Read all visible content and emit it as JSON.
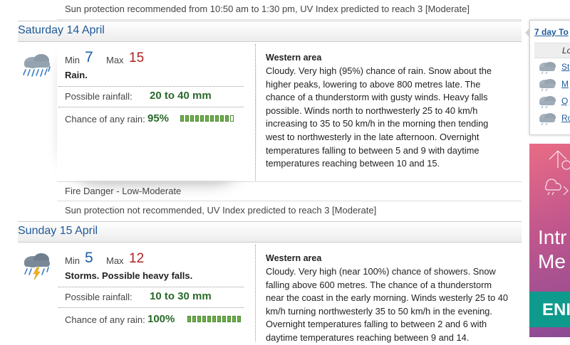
{
  "top_note": "Sun protection recommended from 10:50 am to 1:30 pm, UV Index predicted to reach 3 [Moderate]",
  "days": [
    {
      "header": "Saturday 14 April",
      "min_label": "Min",
      "min": "7",
      "max_label": "Max",
      "max": "15",
      "summary": "Rain.",
      "rainfall_label": "Possible rainfall:",
      "rainfall": "20 to 40 mm",
      "chance_label": "Chance of any rain:",
      "chance": "95%",
      "chance_fraction": 0.95,
      "icon": "rain-cloud-icon",
      "area_title": "Western area",
      "forecast": "Cloudy. Very high (95%) chance of rain. Snow about the higher peaks, lowering to above 800 metres late. The chance of a thunderstorm with gusty winds. Heavy falls possible. Winds north to northwesterly 25 to 40 km/h increasing to 35 to 50 km/h in the morning then tending west to northwesterly in the late afternoon. Overnight temperatures falling to between 5 and 9 with daytime temperatures reaching between 10 and 15.",
      "fire_danger": "Fire Danger - Low-Moderate",
      "sun_note": "Sun protection not recommended, UV Index predicted to reach 3 [Moderate]"
    },
    {
      "header": "Sunday 15 April",
      "min_label": "Min",
      "min": "5",
      "max_label": "Max",
      "max": "12",
      "summary": "Storms. Possible heavy falls.",
      "rainfall_label": "Possible rainfall:",
      "rainfall": "10 to 30 mm",
      "chance_label": "Chance of any rain:",
      "chance": "100%",
      "chance_fraction": 1.0,
      "icon": "storm-cloud-icon",
      "area_title": "Western area",
      "forecast": "Cloudy. Very high (near 100%) chance of showers. Snow falling above 600 metres. The chance of a thunderstorm near the coast in the early morning. Winds westerly 25 to 40 km/h turning northwesterly 35 to 50 km/h in the evening. Overnight temperatures falling to between 2 and 6 with daytime temperatures reaching between 9 and 14."
    }
  ],
  "sidebar": {
    "link": "7 day To",
    "column_header": "Lo",
    "items": [
      "St",
      "M",
      "Q",
      "Ro"
    ],
    "item_icon": "cloud-icon"
  },
  "ad": {
    "line1": "Intr",
    "line2": "Me",
    "button": "ENI"
  },
  "colors": {
    "header_text": "#1f5a99",
    "min_temp": "#1f5da8",
    "max_temp": "#b02020",
    "rain_green": "#2b6a2b",
    "bar_green": "#6fae4c"
  }
}
